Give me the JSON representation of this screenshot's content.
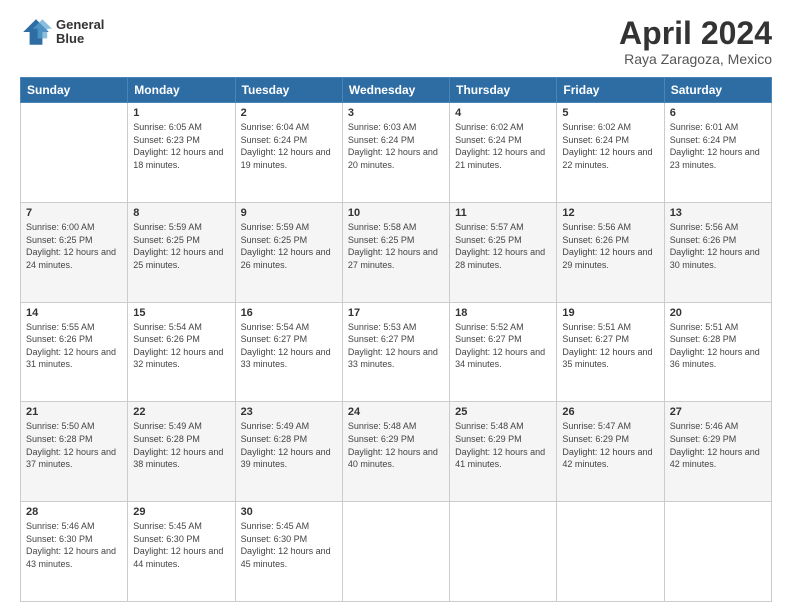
{
  "header": {
    "logo_line1": "General",
    "logo_line2": "Blue",
    "title": "April 2024",
    "subtitle": "Raya Zaragoza, Mexico"
  },
  "days_of_week": [
    "Sunday",
    "Monday",
    "Tuesday",
    "Wednesday",
    "Thursday",
    "Friday",
    "Saturday"
  ],
  "weeks": [
    [
      {
        "day": "",
        "sunrise": "",
        "sunset": "",
        "daylight": ""
      },
      {
        "day": "1",
        "sunrise": "Sunrise: 6:05 AM",
        "sunset": "Sunset: 6:23 PM",
        "daylight": "Daylight: 12 hours and 18 minutes."
      },
      {
        "day": "2",
        "sunrise": "Sunrise: 6:04 AM",
        "sunset": "Sunset: 6:24 PM",
        "daylight": "Daylight: 12 hours and 19 minutes."
      },
      {
        "day": "3",
        "sunrise": "Sunrise: 6:03 AM",
        "sunset": "Sunset: 6:24 PM",
        "daylight": "Daylight: 12 hours and 20 minutes."
      },
      {
        "day": "4",
        "sunrise": "Sunrise: 6:02 AM",
        "sunset": "Sunset: 6:24 PM",
        "daylight": "Daylight: 12 hours and 21 minutes."
      },
      {
        "day": "5",
        "sunrise": "Sunrise: 6:02 AM",
        "sunset": "Sunset: 6:24 PM",
        "daylight": "Daylight: 12 hours and 22 minutes."
      },
      {
        "day": "6",
        "sunrise": "Sunrise: 6:01 AM",
        "sunset": "Sunset: 6:24 PM",
        "daylight": "Daylight: 12 hours and 23 minutes."
      }
    ],
    [
      {
        "day": "7",
        "sunrise": "Sunrise: 6:00 AM",
        "sunset": "Sunset: 6:25 PM",
        "daylight": "Daylight: 12 hours and 24 minutes."
      },
      {
        "day": "8",
        "sunrise": "Sunrise: 5:59 AM",
        "sunset": "Sunset: 6:25 PM",
        "daylight": "Daylight: 12 hours and 25 minutes."
      },
      {
        "day": "9",
        "sunrise": "Sunrise: 5:59 AM",
        "sunset": "Sunset: 6:25 PM",
        "daylight": "Daylight: 12 hours and 26 minutes."
      },
      {
        "day": "10",
        "sunrise": "Sunrise: 5:58 AM",
        "sunset": "Sunset: 6:25 PM",
        "daylight": "Daylight: 12 hours and 27 minutes."
      },
      {
        "day": "11",
        "sunrise": "Sunrise: 5:57 AM",
        "sunset": "Sunset: 6:25 PM",
        "daylight": "Daylight: 12 hours and 28 minutes."
      },
      {
        "day": "12",
        "sunrise": "Sunrise: 5:56 AM",
        "sunset": "Sunset: 6:26 PM",
        "daylight": "Daylight: 12 hours and 29 minutes."
      },
      {
        "day": "13",
        "sunrise": "Sunrise: 5:56 AM",
        "sunset": "Sunset: 6:26 PM",
        "daylight": "Daylight: 12 hours and 30 minutes."
      }
    ],
    [
      {
        "day": "14",
        "sunrise": "Sunrise: 5:55 AM",
        "sunset": "Sunset: 6:26 PM",
        "daylight": "Daylight: 12 hours and 31 minutes."
      },
      {
        "day": "15",
        "sunrise": "Sunrise: 5:54 AM",
        "sunset": "Sunset: 6:26 PM",
        "daylight": "Daylight: 12 hours and 32 minutes."
      },
      {
        "day": "16",
        "sunrise": "Sunrise: 5:54 AM",
        "sunset": "Sunset: 6:27 PM",
        "daylight": "Daylight: 12 hours and 33 minutes."
      },
      {
        "day": "17",
        "sunrise": "Sunrise: 5:53 AM",
        "sunset": "Sunset: 6:27 PM",
        "daylight": "Daylight: 12 hours and 33 minutes."
      },
      {
        "day": "18",
        "sunrise": "Sunrise: 5:52 AM",
        "sunset": "Sunset: 6:27 PM",
        "daylight": "Daylight: 12 hours and 34 minutes."
      },
      {
        "day": "19",
        "sunrise": "Sunrise: 5:51 AM",
        "sunset": "Sunset: 6:27 PM",
        "daylight": "Daylight: 12 hours and 35 minutes."
      },
      {
        "day": "20",
        "sunrise": "Sunrise: 5:51 AM",
        "sunset": "Sunset: 6:28 PM",
        "daylight": "Daylight: 12 hours and 36 minutes."
      }
    ],
    [
      {
        "day": "21",
        "sunrise": "Sunrise: 5:50 AM",
        "sunset": "Sunset: 6:28 PM",
        "daylight": "Daylight: 12 hours and 37 minutes."
      },
      {
        "day": "22",
        "sunrise": "Sunrise: 5:49 AM",
        "sunset": "Sunset: 6:28 PM",
        "daylight": "Daylight: 12 hours and 38 minutes."
      },
      {
        "day": "23",
        "sunrise": "Sunrise: 5:49 AM",
        "sunset": "Sunset: 6:28 PM",
        "daylight": "Daylight: 12 hours and 39 minutes."
      },
      {
        "day": "24",
        "sunrise": "Sunrise: 5:48 AM",
        "sunset": "Sunset: 6:29 PM",
        "daylight": "Daylight: 12 hours and 40 minutes."
      },
      {
        "day": "25",
        "sunrise": "Sunrise: 5:48 AM",
        "sunset": "Sunset: 6:29 PM",
        "daylight": "Daylight: 12 hours and 41 minutes."
      },
      {
        "day": "26",
        "sunrise": "Sunrise: 5:47 AM",
        "sunset": "Sunset: 6:29 PM",
        "daylight": "Daylight: 12 hours and 42 minutes."
      },
      {
        "day": "27",
        "sunrise": "Sunrise: 5:46 AM",
        "sunset": "Sunset: 6:29 PM",
        "daylight": "Daylight: 12 hours and 42 minutes."
      }
    ],
    [
      {
        "day": "28",
        "sunrise": "Sunrise: 5:46 AM",
        "sunset": "Sunset: 6:30 PM",
        "daylight": "Daylight: 12 hours and 43 minutes."
      },
      {
        "day": "29",
        "sunrise": "Sunrise: 5:45 AM",
        "sunset": "Sunset: 6:30 PM",
        "daylight": "Daylight: 12 hours and 44 minutes."
      },
      {
        "day": "30",
        "sunrise": "Sunrise: 5:45 AM",
        "sunset": "Sunset: 6:30 PM",
        "daylight": "Daylight: 12 hours and 45 minutes."
      },
      {
        "day": "",
        "sunrise": "",
        "sunset": "",
        "daylight": ""
      },
      {
        "day": "",
        "sunrise": "",
        "sunset": "",
        "daylight": ""
      },
      {
        "day": "",
        "sunrise": "",
        "sunset": "",
        "daylight": ""
      },
      {
        "day": "",
        "sunrise": "",
        "sunset": "",
        "daylight": ""
      }
    ]
  ]
}
